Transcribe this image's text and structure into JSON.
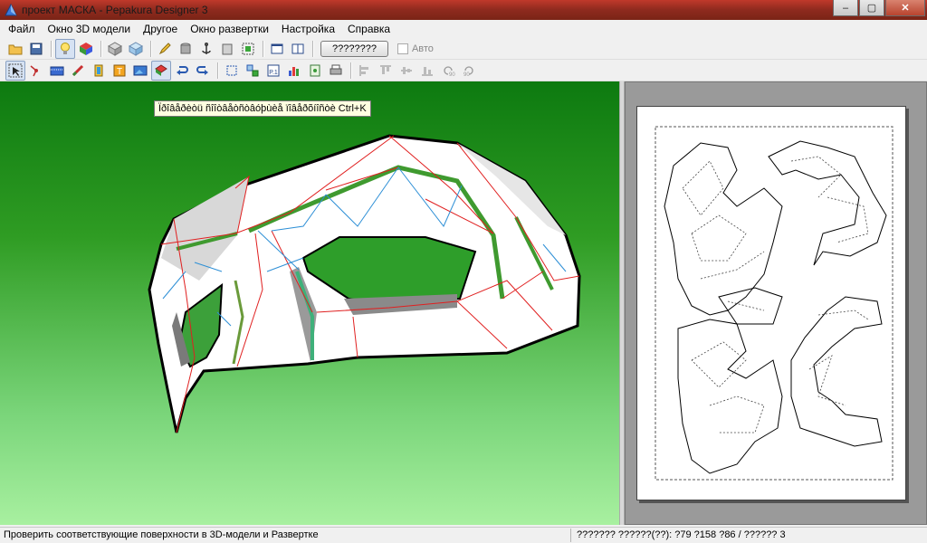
{
  "window": {
    "title": "проект МАСКА - Pepakura Designer 3",
    "buttons": {
      "minimize": "–",
      "maximize": "▢",
      "close": "✕"
    }
  },
  "menu": {
    "items": [
      "Файл",
      "Окно 3D модели",
      "Другое",
      "Окно развертки",
      "Настройка",
      "Справка"
    ]
  },
  "toolbar1": {
    "icons": [
      "open-folder-icon",
      "save-icon",
      "lightbulb-icon",
      "color-cube-icon",
      "box-icon",
      "box-light-icon",
      "pencil-icon",
      "cylinder-icon",
      "anchor-icon",
      "gray-box-icon",
      "green-cube-icon",
      "window-icon",
      "window-alt-icon"
    ],
    "unfold_button": "????????",
    "auto_checkbox": "Авто"
  },
  "toolbar2": {
    "icons": [
      "select-arrow-icon",
      "edge-tool-icon",
      "film-icon",
      "brush-icon",
      "flaps-icon",
      "text-icon",
      "image-icon",
      "check-faces-icon",
      "undo-icon",
      "redo-icon",
      "move-icon",
      "move-parts-icon",
      "page-number-icon",
      "color-bars-icon",
      "calc-icon",
      "print-icon",
      "align-left-icon",
      "align-top-icon",
      "align-center-icon",
      "align-bottom-icon",
      "rotate-90-left-icon",
      "rotate-90-right-icon"
    ]
  },
  "tooltip": "Ïðîâåðèòü ñîîòâåòñòâóþùèå ïîâåðõíîñòè Ctrl+K",
  "colors": {
    "green_dark": "#0d7a10",
    "green_light": "#a8f0a0",
    "cut_line": "#e02020",
    "fold_line": "#2d8fd6",
    "edge_green": "#3f9a2f"
  },
  "status": {
    "message": "Проверить соответствующие поверхности в 3D-модели и Развертке",
    "info": "??????? ??????(??): ?79 ?158 ?86 / ?????? 3"
  }
}
